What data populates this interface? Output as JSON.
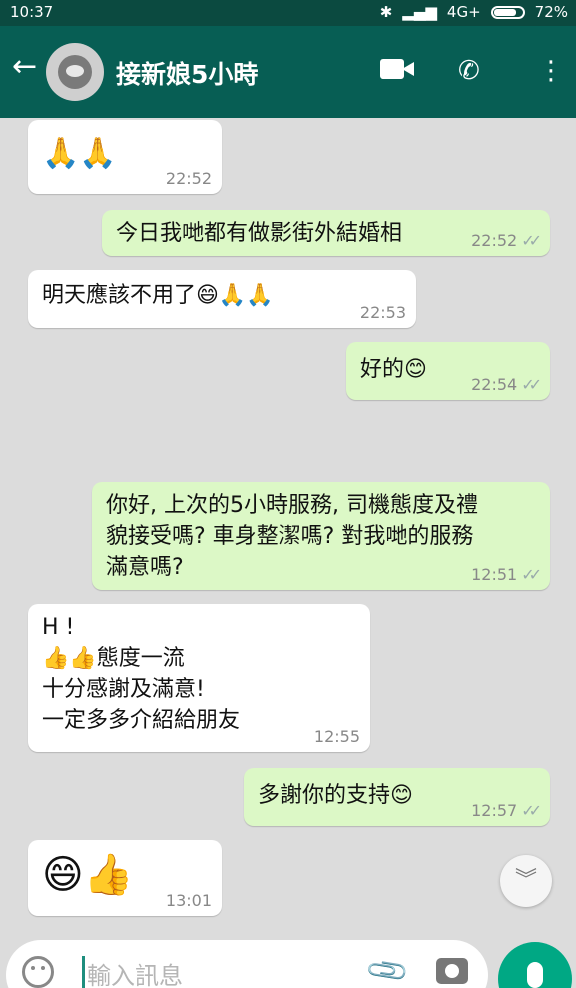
{
  "status_bar": {
    "time": "10:37",
    "network": "4G+",
    "battery": "72%"
  },
  "header": {
    "back_icon": "arrow-left-icon",
    "title": "接新娘5小時",
    "icons": [
      "video-call-icon",
      "phone-icon",
      "more-vert-icon"
    ]
  },
  "messages": [
    {
      "dir": "in",
      "text": "🙏🙏",
      "time": "22:52"
    },
    {
      "dir": "out",
      "text": "今日我哋都有做影街外結婚相",
      "time": "22:52"
    },
    {
      "dir": "in",
      "text": "明天應該不用了😄🙏🙏",
      "time": "22:53"
    },
    {
      "dir": "out",
      "text": "好的😊",
      "time": "22:54"
    },
    {
      "dir": "out",
      "text": "你好, 上次的5小時服務, 司機態度及禮\n貌接受嗎? 車身整潔嗎? 對我哋的服務\n滿意嗎?",
      "time": "12:51"
    },
    {
      "dir": "in",
      "text": "H !\n 👍👍態度一流\n十分感謝及滿意!\n一定多多介紹給朋友",
      "time": "12:55"
    },
    {
      "dir": "out",
      "text": "多謝你的支持😊",
      "time": "12:57"
    },
    {
      "dir": "in",
      "text": "😄👍",
      "time": "13:01"
    }
  ],
  "input": {
    "placeholder": "輸入訊息"
  },
  "colors": {
    "header": "#075e54",
    "status": "#0b4a40",
    "outgoing": "#dcf8c6",
    "incoming": "#ffffff",
    "background": "#dcdcdc",
    "accent": "#00a884"
  }
}
